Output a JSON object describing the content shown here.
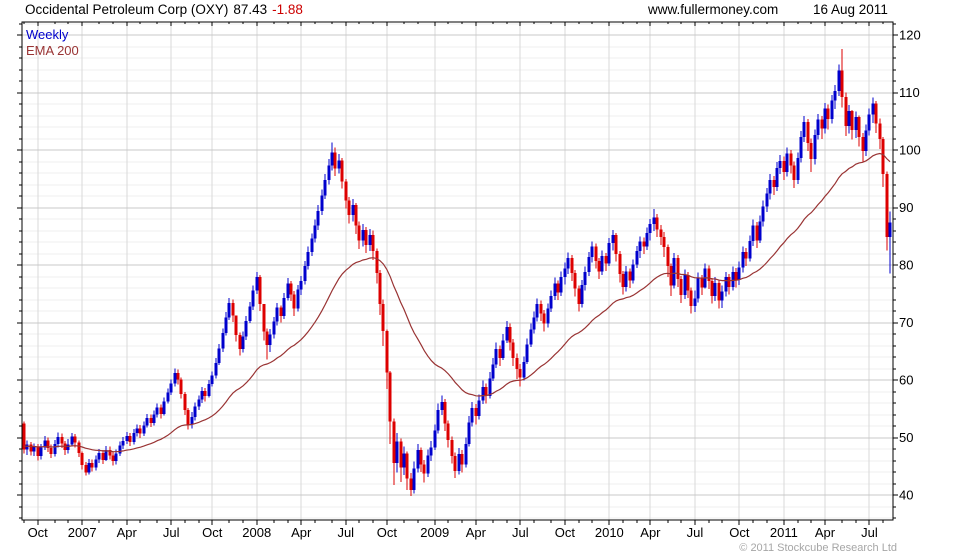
{
  "header": {
    "title": "Occidental Petroleum Corp (OXY)",
    "price": "87.43",
    "change": "-1.88",
    "website": "www.fullermoney.com",
    "date": "16 Aug 2011"
  },
  "legend": {
    "series_label": "Weekly",
    "ema_label": "EMA 200"
  },
  "footer": {
    "copyright": "© 2011 Stockcube Research Ltd"
  },
  "chart_data": {
    "type": "candlestick",
    "title": "Occidental Petroleum Corp (OXY) weekly",
    "last_price": 87.43,
    "change": -1.88,
    "ylim": [
      35.6,
      122.3
    ],
    "y_major_ticks": [
      40,
      50,
      60,
      70,
      80,
      90,
      100,
      110,
      120
    ],
    "y_minor_step": 2,
    "x_quarter_ticks": [
      {
        "week": 4,
        "label": "Oct"
      },
      {
        "week": 17,
        "label": "2007"
      },
      {
        "week": 30,
        "label": "Apr"
      },
      {
        "week": 43,
        "label": "Jul"
      },
      {
        "week": 55,
        "label": "Oct"
      },
      {
        "week": 68,
        "label": "2008"
      },
      {
        "week": 81,
        "label": "Apr"
      },
      {
        "week": 94,
        "label": "Jul"
      },
      {
        "week": 106,
        "label": "Oct"
      },
      {
        "week": 120,
        "label": "2009"
      },
      {
        "week": 132,
        "label": "Apr"
      },
      {
        "week": 145,
        "label": "Jul"
      },
      {
        "week": 158,
        "label": "Oct"
      },
      {
        "week": 171,
        "label": "2010"
      },
      {
        "week": 183,
        "label": "Apr"
      },
      {
        "week": 196,
        "label": "Jul"
      },
      {
        "week": 209,
        "label": "Oct"
      },
      {
        "week": 222,
        "label": "2011"
      },
      {
        "week": 234,
        "label": "Apr"
      },
      {
        "week": 247,
        "label": "Jul"
      }
    ],
    "month_start_weeks": [
      0,
      4,
      9,
      13,
      17,
      22,
      26,
      30,
      34,
      39,
      43,
      47,
      51,
      55,
      60,
      64,
      68,
      73,
      77,
      81,
      85,
      90,
      94,
      98,
      102,
      106,
      111,
      115,
      120,
      124,
      128,
      132,
      137,
      141,
      145,
      149,
      154,
      158,
      162,
      166,
      171,
      175,
      179,
      183,
      188,
      192,
      196,
      200,
      204,
      209,
      213,
      217,
      222,
      226,
      230,
      234,
      239,
      243,
      247,
      251
    ],
    "ema": {
      "label": "EMA 200",
      "period_weeks": 40,
      "seed": 48.5,
      "color": "#993333"
    },
    "colors": {
      "up": "#0000cd",
      "down": "#dd0000",
      "grid_major": "#c9c9c9",
      "grid_minor": "#efefef",
      "grid_vertical": "#d9d9d9",
      "border": "#000000"
    },
    "first_open": 52.4,
    "weeks": [
      [
        47.9,
        52.8,
        47.2
      ],
      [
        48.8,
        49.5,
        47.0
      ],
      [
        47.6,
        49.2,
        46.9
      ],
      [
        48.4,
        49.0,
        46.8
      ],
      [
        46.8,
        48.9,
        46.0
      ],
      [
        48.3,
        48.9,
        46.2
      ],
      [
        49.5,
        50.3,
        47.8
      ],
      [
        48.2,
        50.0,
        47.5
      ],
      [
        47.1,
        48.8,
        46.4
      ],
      [
        48.9,
        49.6,
        46.7
      ],
      [
        50.1,
        50.9,
        48.3
      ],
      [
        49.0,
        50.7,
        48.2
      ],
      [
        47.8,
        49.4,
        47.0
      ],
      [
        48.8,
        49.7,
        47.2
      ],
      [
        50.2,
        50.8,
        48.4
      ],
      [
        49.1,
        50.6,
        48.3
      ],
      [
        47.3,
        49.5,
        46.6
      ],
      [
        45.2,
        47.6,
        44.4
      ],
      [
        43.9,
        45.7,
        43.4
      ],
      [
        45.6,
        46.3,
        43.6
      ],
      [
        44.8,
        46.2,
        44.1
      ],
      [
        46.2,
        46.9,
        44.3
      ],
      [
        47.3,
        48.0,
        45.6
      ],
      [
        46.1,
        47.8,
        45.4
      ],
      [
        47.8,
        48.5,
        45.9
      ],
      [
        46.9,
        48.4,
        46.2
      ],
      [
        45.9,
        47.5,
        45.1
      ],
      [
        47.2,
        47.9,
        45.3
      ],
      [
        48.6,
        49.3,
        46.8
      ],
      [
        49.4,
        50.1,
        48.0
      ],
      [
        50.3,
        51.0,
        48.9
      ],
      [
        49.2,
        50.8,
        48.5
      ],
      [
        50.8,
        51.5,
        48.8
      ],
      [
        51.6,
        52.3,
        50.2
      ],
      [
        50.7,
        52.2,
        49.9
      ],
      [
        52.1,
        52.8,
        50.3
      ],
      [
        53.4,
        54.1,
        51.7
      ],
      [
        52.5,
        54.0,
        51.8
      ],
      [
        54.0,
        54.7,
        52.1
      ],
      [
        55.2,
        55.9,
        53.5
      ],
      [
        54.1,
        55.7,
        53.3
      ],
      [
        56.3,
        57.0,
        53.8
      ],
      [
        57.8,
        58.5,
        55.9
      ],
      [
        59.4,
        60.1,
        57.4
      ],
      [
        61.2,
        62.0,
        58.9
      ],
      [
        60.1,
        61.8,
        59.2
      ],
      [
        57.6,
        60.4,
        56.8
      ],
      [
        54.8,
        57.9,
        53.9
      ],
      [
        52.3,
        55.1,
        51.4
      ],
      [
        53.6,
        54.4,
        51.6
      ],
      [
        55.4,
        56.1,
        53.0
      ],
      [
        56.6,
        57.3,
        54.8
      ],
      [
        58.1,
        58.8,
        56.0
      ],
      [
        57.2,
        58.6,
        56.3
      ],
      [
        59.3,
        60.0,
        57.0
      ],
      [
        60.8,
        61.5,
        58.9
      ],
      [
        63.0,
        63.8,
        60.3
      ],
      [
        65.5,
        66.3,
        62.6
      ],
      [
        68.2,
        69.0,
        64.9
      ],
      [
        70.9,
        71.8,
        67.7
      ],
      [
        73.4,
        74.3,
        70.4
      ],
      [
        71.2,
        74.0,
        70.1
      ],
      [
        67.8,
        71.0,
        66.7
      ],
      [
        65.4,
        68.3,
        64.3
      ],
      [
        67.6,
        68.4,
        64.8
      ],
      [
        70.3,
        71.1,
        67.0
      ],
      [
        72.8,
        73.6,
        69.9
      ],
      [
        75.6,
        76.4,
        72.2
      ],
      [
        77.9,
        78.8,
        75.0
      ],
      [
        73.2,
        78.3,
        72.0
      ],
      [
        68.4,
        73.0,
        66.9
      ],
      [
        66.1,
        69.0,
        63.6
      ],
      [
        67.9,
        68.9,
        64.9
      ],
      [
        70.2,
        71.0,
        67.2
      ],
      [
        72.6,
        73.4,
        69.5
      ],
      [
        71.1,
        73.0,
        70.0
      ],
      [
        74.3,
        75.1,
        70.6
      ],
      [
        76.8,
        77.7,
        73.8
      ],
      [
        74.9,
        77.2,
        73.7
      ],
      [
        72.4,
        75.5,
        71.1
      ],
      [
        75.7,
        76.5,
        71.9
      ],
      [
        77.2,
        78.1,
        74.8
      ],
      [
        79.8,
        80.7,
        76.6
      ],
      [
        82.3,
        83.2,
        79.2
      ],
      [
        84.6,
        85.5,
        81.6
      ],
      [
        86.9,
        87.9,
        83.9
      ],
      [
        89.4,
        90.4,
        86.1
      ],
      [
        92.1,
        93.1,
        88.7
      ],
      [
        94.8,
        95.8,
        91.5
      ],
      [
        97.3,
        98.4,
        94.0
      ],
      [
        99.6,
        101.3,
        96.4
      ],
      [
        96.8,
        100.4,
        95.5
      ],
      [
        98.2,
        99.3,
        95.9
      ],
      [
        94.5,
        98.6,
        93.3
      ],
      [
        91.2,
        95.0,
        89.8
      ],
      [
        88.7,
        91.8,
        87.2
      ],
      [
        90.4,
        91.5,
        87.6
      ],
      [
        86.9,
        90.8,
        85.4
      ],
      [
        84.3,
        87.6,
        82.8
      ],
      [
        86.1,
        87.1,
        83.2
      ],
      [
        83.5,
        86.6,
        82.1
      ],
      [
        85.2,
        86.3,
        82.4
      ],
      [
        82.4,
        86.0,
        80.9
      ],
      [
        78.6,
        82.9,
        76.8
      ],
      [
        73.2,
        79.1,
        71.3
      ],
      [
        68.5,
        74.0,
        65.9
      ],
      [
        61.3,
        68.8,
        58.4
      ],
      [
        52.8,
        61.6,
        48.9
      ],
      [
        45.6,
        53.3,
        41.7
      ],
      [
        49.3,
        50.8,
        43.9
      ],
      [
        44.8,
        49.8,
        42.3
      ],
      [
        47.2,
        48.4,
        43.5
      ],
      [
        42.9,
        47.6,
        40.9
      ],
      [
        40.9,
        43.8,
        39.8
      ],
      [
        44.6,
        45.8,
        40.3
      ],
      [
        47.8,
        48.9,
        43.9
      ],
      [
        45.3,
        48.3,
        44.0
      ],
      [
        43.7,
        46.1,
        42.2
      ],
      [
        46.9,
        47.9,
        43.1
      ],
      [
        48.3,
        49.4,
        45.9
      ],
      [
        51.2,
        52.3,
        47.8
      ],
      [
        54.8,
        55.9,
        50.7
      ],
      [
        56.2,
        57.3,
        53.9
      ],
      [
        52.4,
        56.7,
        51.1
      ],
      [
        49.6,
        53.0,
        48.3
      ],
      [
        46.8,
        50.2,
        45.5
      ],
      [
        44.2,
        47.4,
        43.0
      ],
      [
        47.1,
        48.2,
        43.6
      ],
      [
        45.3,
        47.8,
        43.9
      ],
      [
        48.9,
        50.0,
        44.8
      ],
      [
        52.6,
        53.7,
        48.4
      ],
      [
        55.1,
        56.2,
        51.9
      ],
      [
        53.7,
        55.8,
        52.3
      ],
      [
        56.4,
        57.5,
        53.1
      ],
      [
        58.8,
        59.9,
        55.8
      ],
      [
        57.2,
        59.4,
        55.9
      ],
      [
        60.3,
        61.4,
        56.8
      ],
      [
        62.7,
        63.8,
        59.8
      ],
      [
        65.4,
        66.5,
        62.1
      ],
      [
        63.8,
        66.0,
        62.4
      ],
      [
        66.9,
        68.0,
        63.5
      ],
      [
        69.2,
        70.3,
        66.4
      ],
      [
        66.5,
        69.8,
        65.1
      ],
      [
        63.8,
        67.1,
        62.4
      ],
      [
        61.9,
        64.6,
        60.2
      ],
      [
        60.4,
        62.8,
        58.9
      ],
      [
        63.1,
        64.1,
        59.9
      ],
      [
        66.2,
        67.2,
        62.8
      ],
      [
        68.8,
        69.8,
        65.7
      ],
      [
        70.9,
        71.9,
        68.1
      ],
      [
        73.2,
        74.2,
        70.2
      ],
      [
        71.6,
        73.8,
        70.3
      ],
      [
        69.8,
        72.2,
        68.4
      ],
      [
        72.4,
        73.3,
        69.1
      ],
      [
        74.6,
        75.6,
        71.8
      ],
      [
        76.8,
        77.8,
        73.9
      ],
      [
        75.2,
        77.3,
        73.9
      ],
      [
        77.9,
        78.9,
        74.6
      ],
      [
        79.4,
        80.4,
        76.6
      ],
      [
        81.2,
        82.2,
        78.4
      ],
      [
        78.6,
        81.7,
        77.2
      ],
      [
        75.9,
        79.1,
        74.5
      ],
      [
        73.2,
        76.4,
        71.9
      ],
      [
        76.5,
        77.4,
        72.6
      ],
      [
        78.8,
        79.7,
        75.6
      ],
      [
        81.4,
        82.3,
        78.1
      ],
      [
        83.2,
        84.1,
        80.4
      ],
      [
        80.7,
        83.7,
        79.4
      ],
      [
        78.9,
        81.2,
        77.6
      ],
      [
        81.6,
        82.5,
        78.3
      ],
      [
        80.3,
        82.1,
        79.0
      ],
      [
        83.8,
        84.7,
        79.8
      ],
      [
        85.2,
        86.1,
        82.5
      ],
      [
        81.9,
        85.6,
        80.6
      ],
      [
        78.4,
        82.4,
        77.0
      ],
      [
        76.2,
        79.0,
        74.9
      ],
      [
        78.9,
        79.8,
        75.4
      ],
      [
        77.3,
        79.4,
        76.0
      ],
      [
        80.1,
        81.0,
        76.8
      ],
      [
        82.4,
        83.3,
        79.5
      ],
      [
        84.1,
        85.0,
        81.2
      ],
      [
        83.2,
        84.8,
        81.9
      ],
      [
        85.6,
        86.5,
        82.6
      ],
      [
        87.1,
        88.0,
        84.3
      ],
      [
        88.3,
        89.7,
        85.9
      ],
      [
        86.2,
        88.9,
        84.9
      ],
      [
        84.9,
        87.0,
        83.5
      ],
      [
        83.1,
        85.7,
        81.4
      ],
      [
        79.8,
        83.6,
        77.9
      ],
      [
        76.4,
        80.3,
        74.6
      ],
      [
        81.2,
        82.1,
        75.9
      ],
      [
        77.6,
        81.7,
        76.2
      ],
      [
        74.8,
        78.1,
        73.4
      ],
      [
        78.3,
        79.2,
        74.1
      ],
      [
        75.6,
        78.8,
        74.3
      ],
      [
        72.9,
        76.1,
        71.6
      ],
      [
        74.2,
        75.6,
        71.8
      ],
      [
        77.8,
        78.7,
        73.5
      ],
      [
        76.1,
        78.3,
        74.8
      ],
      [
        79.4,
        80.3,
        75.9
      ],
      [
        77.2,
        79.9,
        75.8
      ],
      [
        74.6,
        77.7,
        73.3
      ],
      [
        76.9,
        77.9,
        73.7
      ],
      [
        73.8,
        77.4,
        72.4
      ],
      [
        75.4,
        76.4,
        72.5
      ],
      [
        77.9,
        78.8,
        74.5
      ],
      [
        76.2,
        78.4,
        74.9
      ],
      [
        78.8,
        79.7,
        75.6
      ],
      [
        77.4,
        79.5,
        76.1
      ],
      [
        79.6,
        80.6,
        76.5
      ],
      [
        82.3,
        83.2,
        78.7
      ],
      [
        81.1,
        83.0,
        79.8
      ],
      [
        84.2,
        85.1,
        80.6
      ],
      [
        86.9,
        87.9,
        83.3
      ],
      [
        84.3,
        87.5,
        83.0
      ],
      [
        87.6,
        88.6,
        83.8
      ],
      [
        90.2,
        91.2,
        86.7
      ],
      [
        92.4,
        93.4,
        89.2
      ],
      [
        94.8,
        95.8,
        91.4
      ],
      [
        93.6,
        95.5,
        92.2
      ],
      [
        96.9,
        97.9,
        92.9
      ],
      [
        98.1,
        99.1,
        95.8
      ],
      [
        96.2,
        98.9,
        94.8
      ],
      [
        99.4,
        100.4,
        95.4
      ],
      [
        97.3,
        100.0,
        95.9
      ],
      [
        94.8,
        98.0,
        93.4
      ],
      [
        98.6,
        99.6,
        94.1
      ],
      [
        102.3,
        103.3,
        97.8
      ],
      [
        104.9,
        105.9,
        101.4
      ],
      [
        101.2,
        105.4,
        99.8
      ],
      [
        98.4,
        102.0,
        96.2
      ],
      [
        102.6,
        103.6,
        97.5
      ],
      [
        105.3,
        106.3,
        101.8
      ],
      [
        103.7,
        105.9,
        101.9
      ],
      [
        107.2,
        108.2,
        102.9
      ],
      [
        105.4,
        107.9,
        103.6
      ],
      [
        108.6,
        109.6,
        104.6
      ],
      [
        110.3,
        111.3,
        107.1
      ],
      [
        113.8,
        114.9,
        109.4
      ],
      [
        109.2,
        117.6,
        107.4
      ],
      [
        104.2,
        110.0,
        102.4
      ],
      [
        106.8,
        107.8,
        102.9
      ],
      [
        103.5,
        107.0,
        101.8
      ],
      [
        105.7,
        106.7,
        102.1
      ],
      [
        102.3,
        106.0,
        100.6
      ],
      [
        99.8,
        103.0,
        97.9
      ],
      [
        103.4,
        104.4,
        99.0
      ],
      [
        106.2,
        107.2,
        102.5
      ],
      [
        108.1,
        109.1,
        104.7
      ],
      [
        104.6,
        108.5,
        103.0
      ],
      [
        101.9,
        105.5,
        100.2
      ],
      [
        95.8,
        102.3,
        93.6
      ],
      [
        84.9,
        96.3,
        82.5
      ],
      [
        87.4,
        89.3,
        78.5
      ]
    ]
  }
}
